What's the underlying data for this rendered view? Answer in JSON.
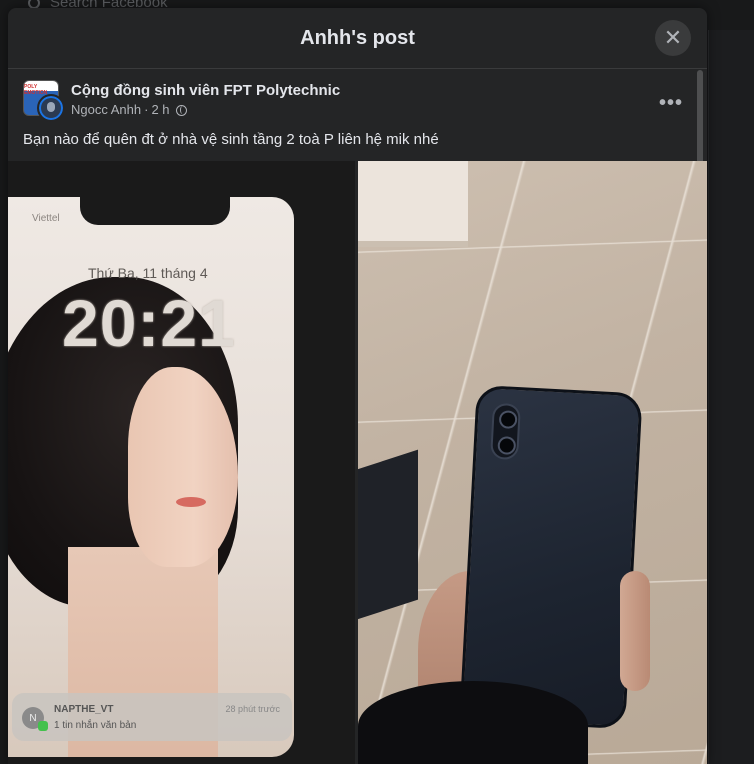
{
  "background": {
    "search_placeholder": "Search Facebook"
  },
  "modal": {
    "title": "Anhh's post",
    "close_icon": "close-icon"
  },
  "post": {
    "group_name": "Cộng đồng sinh viên FPT Polytechnic",
    "author": "Ngocc Anhh",
    "time": "2 h",
    "separator": "·",
    "privacy_icon": "globe-icon",
    "more_icon": "more-options-icon",
    "more_label": "•••",
    "text": "Bạn nào để quên đt ở nhà vệ sinh tầng 2 toà P liên hệ mik nhé",
    "group_avatar_text": "POLY EMOTION"
  },
  "photo_left": {
    "carrier": "Viettel",
    "lock_date": "Thứ Ba, 11 tháng 4",
    "lock_time": "20:21",
    "notification": {
      "initial": "N",
      "sender": "NAPTHE_VT",
      "message": "1 tin nhắn văn bản",
      "time": "28 phút trước"
    }
  }
}
